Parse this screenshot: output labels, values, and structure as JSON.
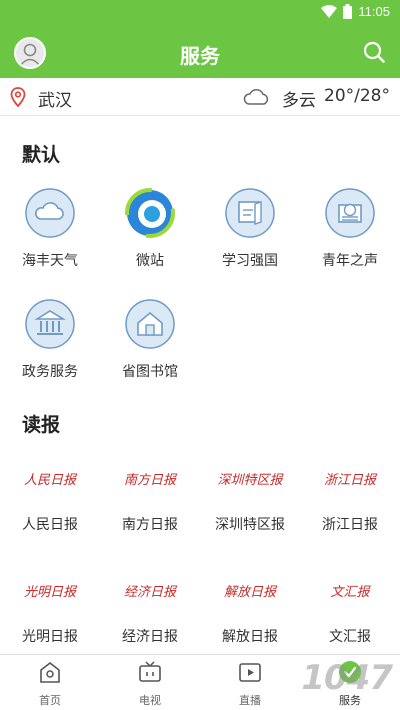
{
  "status_bar": {
    "time": "11:05"
  },
  "app_bar": {
    "title": "服务"
  },
  "weather": {
    "city": "武汉",
    "condition": "多云",
    "temperature": "20°/28°"
  },
  "sections": {
    "default_title": "默认",
    "news_title": "读报"
  },
  "services": [
    {
      "label": "海丰天气",
      "icon": "cloud-icon"
    },
    {
      "label": "微站",
      "icon": "microsite-icon"
    },
    {
      "label": "学习强国",
      "icon": "study-icon"
    },
    {
      "label": "青年之声",
      "icon": "youth-voice-icon"
    },
    {
      "label": "政务服务",
      "icon": "government-icon"
    },
    {
      "label": "省图书馆",
      "icon": "library-icon"
    }
  ],
  "newspapers": [
    {
      "label": "人民日报",
      "logo": "人民日报"
    },
    {
      "label": "南方日报",
      "logo": "南方日报"
    },
    {
      "label": "深圳特区报",
      "logo": "深圳特区报"
    },
    {
      "label": "浙江日报",
      "logo": "浙江日报"
    },
    {
      "label": "光明日报",
      "logo": "光明日报"
    },
    {
      "label": "经济日报",
      "logo": "经济日报"
    },
    {
      "label": "解放日报",
      "logo": "解放日报"
    },
    {
      "label": "文汇报",
      "logo": "文汇报"
    }
  ],
  "tabs": [
    {
      "label": "首页",
      "icon": "home-icon"
    },
    {
      "label": "电视",
      "icon": "tv-icon"
    },
    {
      "label": "直播",
      "icon": "live-icon"
    },
    {
      "label": "服务",
      "icon": "service-icon"
    }
  ],
  "watermark": "1047",
  "colors": {
    "accent": "#6cc644",
    "icon_bg": "#dbe8f5",
    "icon_stroke": "#6f9bc6",
    "newspaper_red": "#c62b2b"
  }
}
